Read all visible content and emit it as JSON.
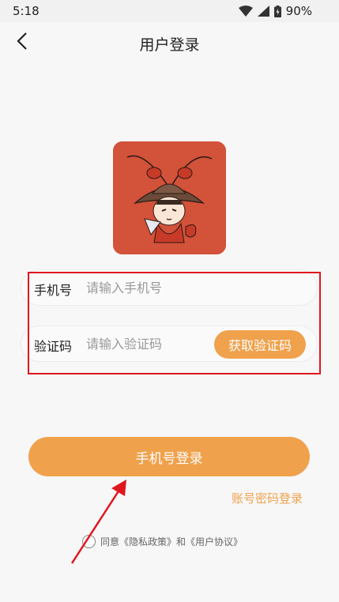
{
  "status_bar": {
    "time": "5:18",
    "battery_percent": "90%",
    "icons": [
      "wifi-icon",
      "signal-icon",
      "battery-icon"
    ]
  },
  "app_bar": {
    "back_icon": "back-arrow-icon",
    "title": "用户登录"
  },
  "logo": {
    "icon": "lobster-mascot-logo",
    "background_color": "#d2523a"
  },
  "form": {
    "phone": {
      "label": "手机号",
      "placeholder": "请输入手机号",
      "value": ""
    },
    "code": {
      "label": "验证码",
      "placeholder": "请输入验证码",
      "value": "",
      "get_code_button": "获取验证码"
    }
  },
  "login_button": "手机号登录",
  "account_login_link": "账号密码登录",
  "agreement": {
    "checked": false,
    "text": "同意《隐私政策》和《用户协议》"
  },
  "colors": {
    "accent": "#f0a14c",
    "annotation": "#e0161e"
  }
}
